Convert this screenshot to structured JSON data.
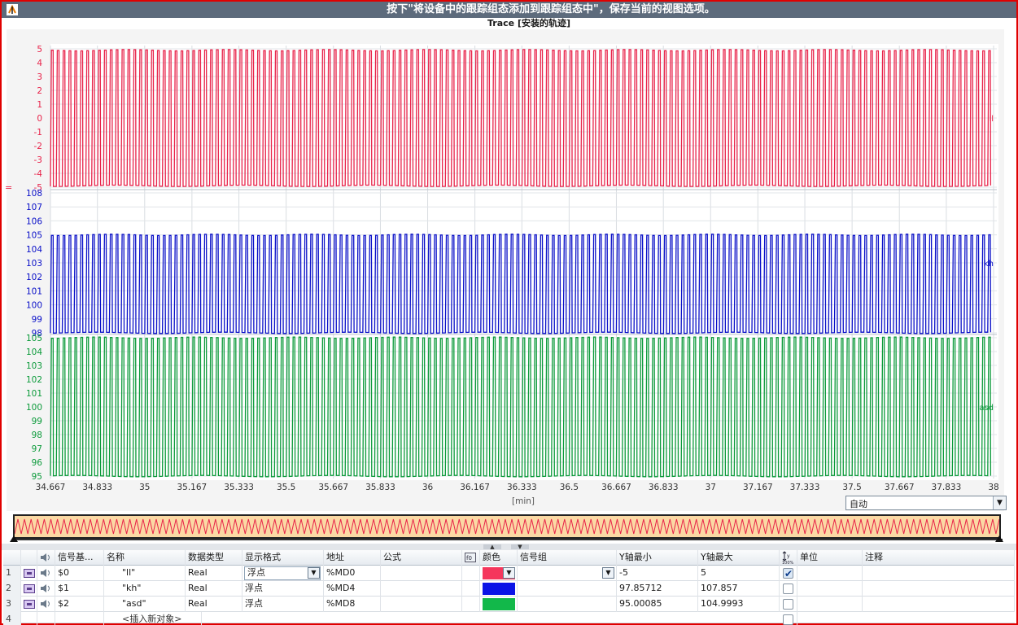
{
  "banner": {
    "message": "按下\"将设备中的跟踪组态添加到跟踪组态中\"，保存当前的视图选项。"
  },
  "trace": {
    "title": "Trace [安装的轨迹]"
  },
  "chart_data": {
    "type": "line",
    "title": "Trace [安装的轨迹]",
    "xlabel": "[min]",
    "x_ticks": [
      "34.667",
      "34.833",
      "35",
      "35.167",
      "35.333",
      "35.5",
      "35.667",
      "35.833",
      "36",
      "36.167",
      "36.333",
      "36.5",
      "36.667",
      "36.833",
      "37",
      "37.167",
      "37.333",
      "37.5",
      "37.667",
      "37.833",
      "38"
    ],
    "xlim": [
      34.667,
      38
    ],
    "grid": true,
    "panels": [
      {
        "series": "ll",
        "color": "#e8234a",
        "ylim": [
          -5,
          5
        ],
        "y_ticks": [
          "5",
          "4",
          "3",
          "2",
          "1",
          "0",
          "-1",
          "-2",
          "-3",
          "-4",
          "-5"
        ],
        "signal_low": -4.9,
        "signal_high": 4.9,
        "cycles": 160
      },
      {
        "series": "kh",
        "color": "#0a10c8",
        "ylim": [
          98,
          108
        ],
        "y_ticks": [
          "108",
          "107",
          "106",
          "105",
          "104",
          "103",
          "102",
          "101",
          "100",
          "99",
          "98"
        ],
        "signal_low": 98.0,
        "signal_high": 105.0,
        "cycles": 160
      },
      {
        "series": "asd",
        "color": "#0b9a3a",
        "ylim": [
          95,
          105
        ],
        "y_ticks": [
          "105",
          "104",
          "103",
          "102",
          "101",
          "100",
          "99",
          "98",
          "97",
          "96",
          "95"
        ],
        "signal_low": 95.0,
        "signal_high": 105.0,
        "cycles": 160
      }
    ]
  },
  "zoom": {
    "value": "自动"
  },
  "signal_table": {
    "headers": {
      "signal_base": "信号基...",
      "name": "名称",
      "data_type": "数据类型",
      "display_format": "显示格式",
      "address": "地址",
      "formula": "公式",
      "color": "颜色",
      "signal_group": "信号组",
      "y_min": "Y轴最小",
      "y_max": "Y轴最大",
      "unit": "单位",
      "comment": "注释"
    },
    "rows": [
      {
        "num": "1",
        "base": "$0",
        "name": "\"ll\"",
        "type": "Real",
        "format": "浮点",
        "address": "%MD0",
        "color": "#f5365c",
        "y_min": "-5",
        "y_max": "5",
        "checked": true
      },
      {
        "num": "2",
        "base": "$1",
        "name": "\"kh\"",
        "type": "Real",
        "format": "浮点",
        "address": "%MD4",
        "color": "#0a14e6",
        "y_min": "97.85712",
        "y_max": "107.857",
        "checked": false
      },
      {
        "num": "3",
        "base": "$2",
        "name": "\"asd\"",
        "type": "Real",
        "format": "浮点",
        "address": "%MD8",
        "color": "#12b84a",
        "y_min": "95.00085",
        "y_max": "104.9993",
        "checked": false
      }
    ],
    "add_row": {
      "num": "4",
      "label": "<插入新对象>"
    }
  }
}
